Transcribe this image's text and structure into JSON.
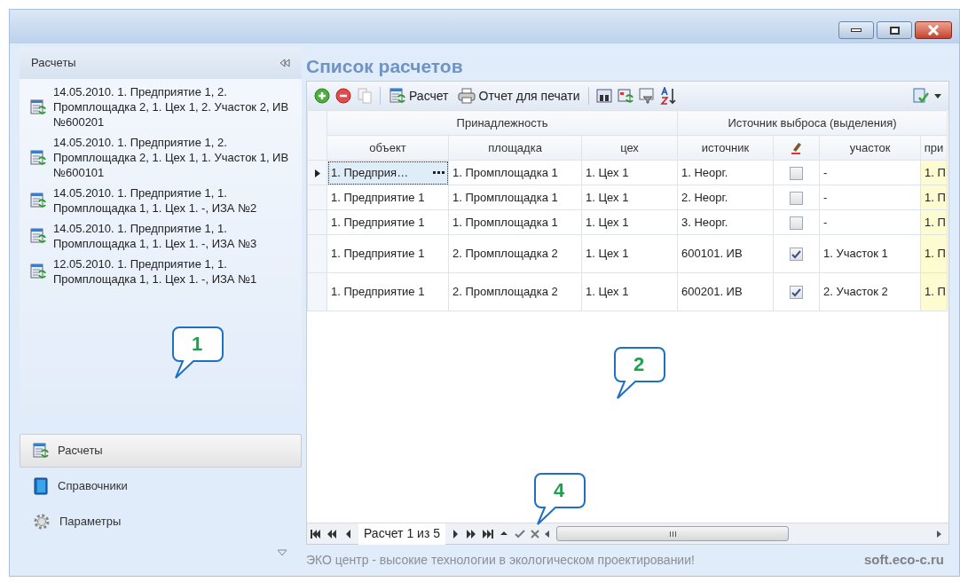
{
  "sidebar": {
    "title": "Расчеты",
    "items": [
      {
        "text": "14.05.2010. 1. Предприятие 1, 2. Промплощадка 2, 1. Цех 1, 2. Участок 2, ИВ №600201"
      },
      {
        "text": "14.05.2010. 1. Предприятие 1, 2. Промплощадка 2, 1. Цех 1, 1. Участок 1, ИВ №600101"
      },
      {
        "text": "14.05.2010. 1. Предприятие 1, 1. Промплощадка 1, 1. Цех 1. -, ИЗА №2"
      },
      {
        "text": "14.05.2010. 1. Предприятие 1, 1. Промплощадка 1, 1. Цех 1. -, ИЗА №3"
      },
      {
        "text": "12.05.2010. 1. Предприятие 1, 1. Промплощадка 1, 1. Цех 1. -, ИЗА №1"
      }
    ],
    "nav": [
      {
        "kind": "calc",
        "label": "Расчеты",
        "selected": true
      },
      {
        "kind": "book",
        "label": "Справочники",
        "selected": false
      },
      {
        "kind": "gear",
        "label": "Параметры",
        "selected": false
      }
    ]
  },
  "main": {
    "title": "Список расчетов",
    "toolbar": [
      {
        "kind": "add"
      },
      {
        "kind": "remove"
      },
      {
        "kind": "copy"
      },
      {
        "kind": "sep"
      },
      {
        "kind": "calc",
        "label": "Расчет"
      },
      {
        "kind": "print",
        "label": "Отчет для печати"
      },
      {
        "kind": "sep"
      },
      {
        "kind": "find"
      },
      {
        "kind": "refresh"
      },
      {
        "kind": "filter"
      },
      {
        "kind": "sort"
      }
    ],
    "table": {
      "groups": [
        {
          "label": "Принадлежность"
        },
        {
          "label": "Источник выброса (выделения)"
        }
      ],
      "columns": [
        "объект",
        "площадка",
        "цех",
        "источник",
        {
          "kind": "icon"
        },
        "участок",
        "при"
      ],
      "rows": [
        {
          "selected": true,
          "tall": false,
          "cells": [
            "1. Предприя…",
            "1. Промплощадка 1",
            "1. Цех 1",
            "1. Неорг.",
            false,
            "-",
            "1. П"
          ]
        },
        {
          "selected": false,
          "tall": false,
          "cells": [
            "1. Предприятие 1",
            "1. Промплощадка 1",
            "1. Цех 1",
            "2. Неорг.",
            false,
            "-",
            "1. П"
          ]
        },
        {
          "selected": false,
          "tall": false,
          "cells": [
            "1. Предприятие 1",
            "1. Промплощадка 1",
            "1. Цех 1",
            "3. Неорг.",
            false,
            "-",
            "1. П"
          ]
        },
        {
          "selected": false,
          "tall": true,
          "cells": [
            "1. Предприятие 1",
            "2. Промплощадка 2",
            "1. Цех 1",
            "600101. ИВ",
            true,
            "1. Участок 1",
            "1. П"
          ]
        },
        {
          "selected": false,
          "tall": true,
          "cells": [
            "1. Предприятие 1",
            "2. Промплощадка 2",
            "1. Цех 1",
            "600201. ИВ",
            true,
            "2. Участок 2",
            "1. П"
          ]
        }
      ]
    },
    "pager": {
      "text": "Расчет 1 из 5"
    }
  },
  "footer": {
    "slogan": "ЭКО центр - высокие технологии в экологическом проектировании!",
    "site": "soft.eco-c.ru"
  },
  "callouts": [
    {
      "label": "1"
    },
    {
      "label": "2"
    },
    {
      "label": "4"
    }
  ]
}
